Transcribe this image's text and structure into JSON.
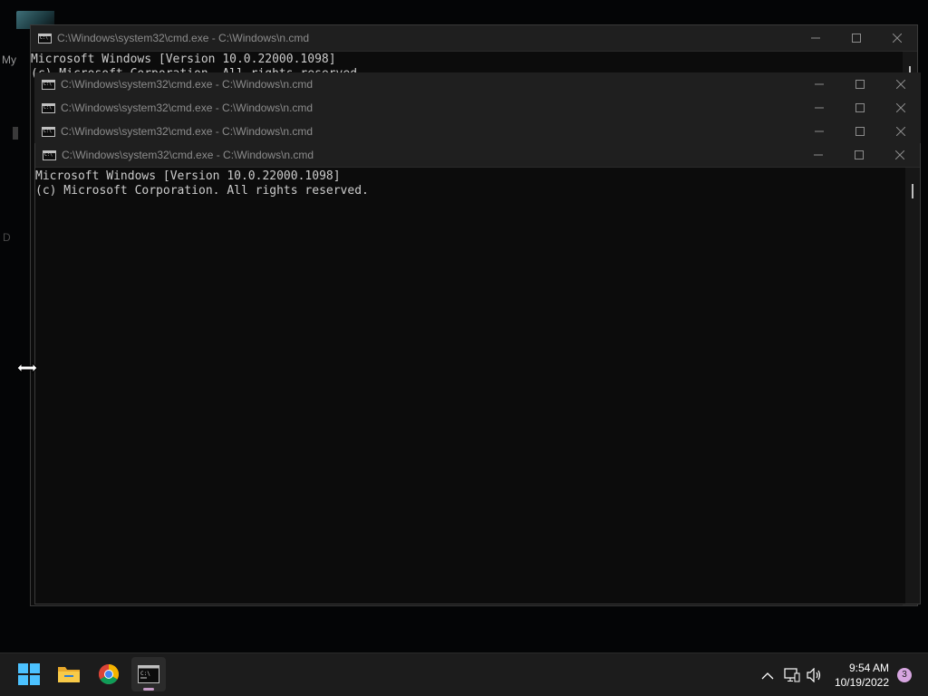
{
  "desktop": {
    "label_my": "My",
    "label_d": "D"
  },
  "windows": [
    {
      "title": "C:\\Windows\\system32\\cmd.exe - C:\\Windows\\n.cmd"
    },
    {
      "title": "C:\\Windows\\system32\\cmd.exe - C:\\Windows\\n.cmd"
    },
    {
      "title": "C:\\Windows\\system32\\cmd.exe - C:\\Windows\\n.cmd"
    },
    {
      "title": "C:\\Windows\\system32\\cmd.exe - C:\\Windows\\n.cmd"
    },
    {
      "title": "C:\\Windows\\system32\\cmd.exe - C:\\Windows\\n.cmd"
    }
  ],
  "back_console": {
    "line1": "Microsoft Windows [Version 10.0.22000.1098]",
    "line2": "(c) Microsoft Corporation. All rights reserved."
  },
  "front_console": {
    "line1": "Microsoft Windows [Version 10.0.22000.1098]",
    "line2": "(c) Microsoft Corporation. All rights reserved."
  },
  "taskbar": {
    "apps": [
      "start-icon",
      "file-explorer-icon",
      "chrome-icon",
      "terminal-icon"
    ],
    "time": "9:54 AM",
    "date": "10/19/2022",
    "notification_count": "3"
  },
  "colors": {
    "console_bg": "#0c0c0c",
    "titlebar_bg": "#1f1f1f",
    "taskbar_bg": "#1c1c1c",
    "indicator": "#c49ac6"
  }
}
